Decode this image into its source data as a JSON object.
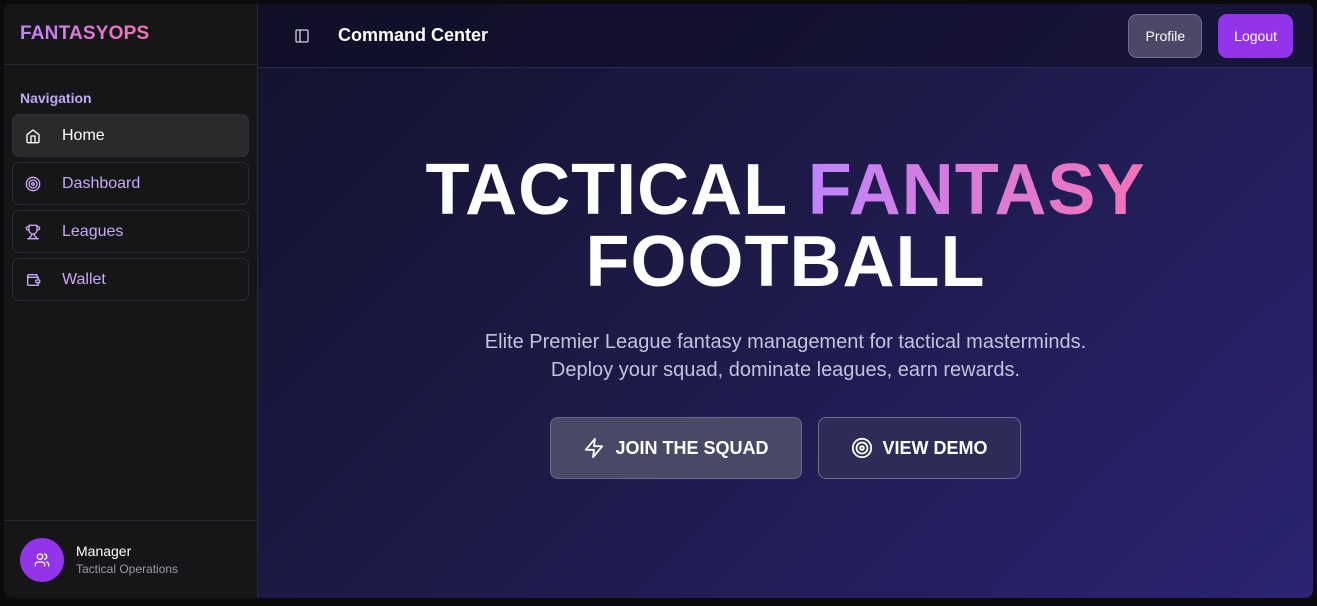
{
  "brand": {
    "name": "FANTASYOPS"
  },
  "sidebar": {
    "section_title": "Navigation",
    "items": [
      {
        "label": "Home",
        "icon": "home-icon",
        "active": true
      },
      {
        "label": "Dashboard",
        "icon": "target-icon",
        "active": false
      },
      {
        "label": "Leagues",
        "icon": "trophy-icon",
        "active": false
      },
      {
        "label": "Wallet",
        "icon": "wallet-icon",
        "active": false
      }
    ],
    "user": {
      "name": "Manager",
      "role": "Tactical Operations",
      "avatar_icon": "users-icon"
    }
  },
  "header": {
    "title": "Command Center",
    "toggle_icon": "sidebar-toggle-icon",
    "profile_label": "Profile",
    "logout_label": "Logout"
  },
  "hero": {
    "title_part1": "TACTICAL ",
    "title_accent": "FANTASY",
    "title_part2": "FOOTBALL",
    "subtitle_line1": "Elite Premier League fantasy management for tactical masterminds.",
    "subtitle_line2": "Deploy your squad, dominate leagues, earn rewards.",
    "primary_button": {
      "label": "JOIN THE SQUAD",
      "icon": "lightning-icon"
    },
    "secondary_button": {
      "label": "VIEW DEMO",
      "icon": "target-icon"
    }
  },
  "colors": {
    "accent": "#9333ea",
    "gradient_start": "#c084fc",
    "gradient_end": "#f472b6",
    "sidebar_bg": "#161618",
    "main_bg_dark": "#13122d",
    "main_bg_light": "#2a2473"
  }
}
